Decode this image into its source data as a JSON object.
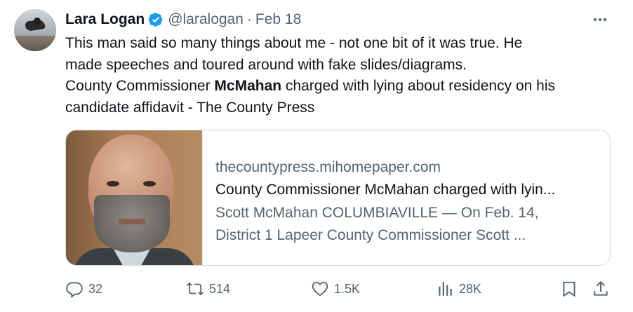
{
  "author": {
    "display_name": "Lara Logan",
    "handle": "@laralogan",
    "separator": "·",
    "date": "Feb 18"
  },
  "tweet": {
    "line1": "This man said so many things about me - not one bit of it was true. He",
    "line2": "made speeches and toured around with fake slides/diagrams.",
    "line3_pre": "County Commissioner ",
    "line3_bold": "McMahan",
    "line3_post": " charged with lying about residency on his",
    "line4": "candidate affidavit - The County Press"
  },
  "card": {
    "domain": "thecountypress.mihomepaper.com",
    "title": "County Commissioner McMahan charged with lyin...",
    "desc_line1": "Scott McMahan COLUMBIAVILLE — On Feb. 14,",
    "desc_line2": "District 1 Lapeer County Commissioner Scott ..."
  },
  "actions": {
    "replies": "32",
    "reposts": "514",
    "likes": "1.5K",
    "views": "28K"
  },
  "colors": {
    "text": "#0f1419",
    "secondary": "#536471",
    "verified": "#1d9bf0",
    "border": "#cfd9de"
  },
  "icons": [
    "verified-badge-icon",
    "more-icon",
    "reply-icon",
    "repost-icon",
    "like-icon",
    "views-icon",
    "bookmark-icon",
    "share-icon"
  ]
}
